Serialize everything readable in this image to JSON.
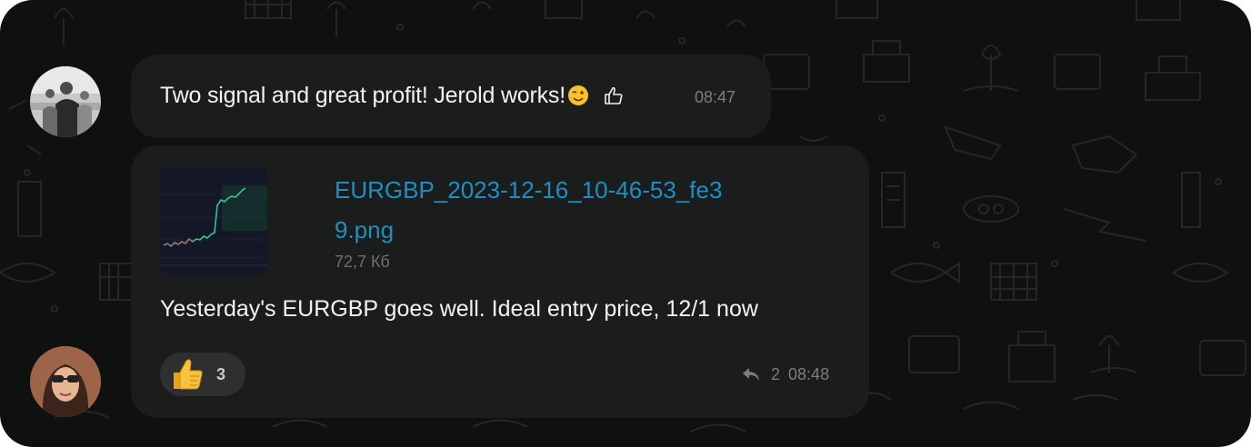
{
  "messages": [
    {
      "text": "Two signal and great profit! Jerold works!",
      "emojis": [
        "winking-face",
        "thumbs-up-outline"
      ],
      "time": "08:47"
    },
    {
      "file": {
        "name": "EURGBP_2023-12-16_10-46-53_fe39.png",
        "size": "72,7 Кб"
      },
      "text": "Yesterday's EURGBP goes well. Ideal entry price, 12/1 now",
      "reaction": {
        "emoji": "thumbs-up",
        "count": "3"
      },
      "replies": "2",
      "time": "08:48"
    }
  ],
  "colors": {
    "background": "#0f1111",
    "bubble": "#1b1d1d",
    "link": "#1f8fbf",
    "text": "#f2f2f2",
    "muted": "#7b7e80"
  }
}
